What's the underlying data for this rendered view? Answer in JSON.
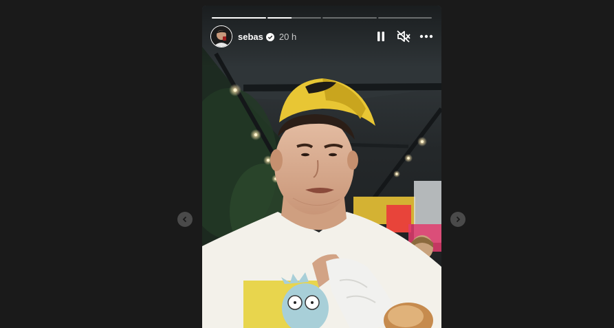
{
  "story": {
    "username": "sebas",
    "verified": true,
    "time_ago": "20 h",
    "progress": [
      1.0,
      0.45,
      0.0,
      0.0
    ]
  },
  "controls": {
    "pause_icon": "pause-icon",
    "mute_icon": "speaker-muted-icon",
    "more_icon": "more-options-icon"
  },
  "navigation": {
    "prev_icon": "chevron-left-icon",
    "next_icon": "chevron-right-icon"
  },
  "colors": {
    "page_background": "#1a1a1a",
    "cap": "#e8c634",
    "shirt": "#f3f1ea",
    "verified_badge": "#ffffff"
  }
}
